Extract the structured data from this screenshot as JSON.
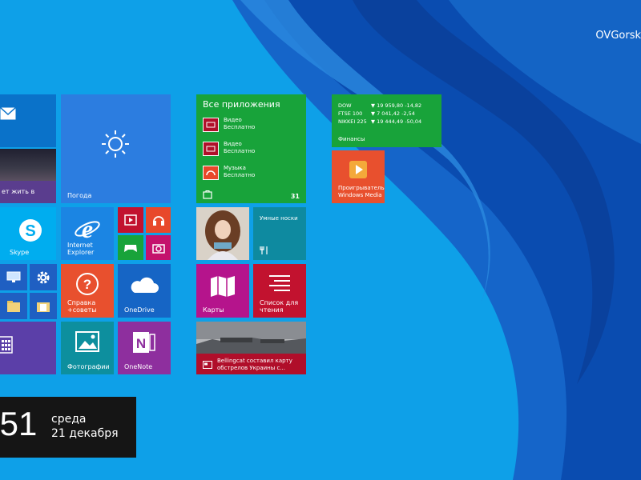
{
  "user": {
    "name": "OVGorsk"
  },
  "tiles": {
    "weather": "Погода",
    "news_snippet": "ет жить в",
    "skype": "Skype",
    "ie": "Internet Explorer",
    "help": "Справка\n+советы",
    "onedrive": "OneDrive",
    "photos": "Фотографии",
    "onenote": "OneNote",
    "all_apps": {
      "title": "Все приложения",
      "items": [
        {
          "name": "Видео",
          "sub": "Бесплатно"
        },
        {
          "name": "Видео",
          "sub": "Бесплатно"
        },
        {
          "name": "Музыка",
          "sub": "Бесплатно"
        }
      ],
      "count": "31"
    },
    "smart_socks": "Умные носки",
    "maps": "Карты",
    "reading_list": "Список для\nчтения",
    "news_headline": "Bellingcat составил карту\nобстрелов Украины с...",
    "finance": {
      "label": "Финансы",
      "rows": [
        {
          "name": "DOW",
          "value": "▼ 19 959,80 -14,82"
        },
        {
          "name": "FTSE 100",
          "value": "▼ 7 041,42 -2,54"
        },
        {
          "name": "NIKKEI 225",
          "value": "▼ 19 444,49 -50,04"
        }
      ]
    },
    "wmp": "Проигрыватель\nWindows Media"
  },
  "clock": {
    "time": ":51",
    "day": "среда",
    "date": "21 декабря"
  }
}
